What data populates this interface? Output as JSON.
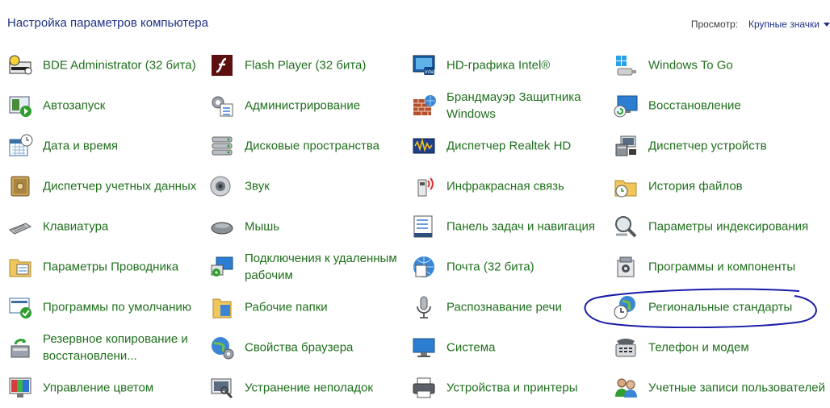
{
  "header": {
    "title": "Настройка параметров компьютера",
    "view_label": "Просмотр:",
    "view_value": "Крупные значки"
  },
  "items": [
    {
      "label": "BDE Administrator (32 бита)",
      "icon": "bde-admin-icon"
    },
    {
      "label": "Flash Player (32 бита)",
      "icon": "flash-player-icon"
    },
    {
      "label": "HD-графика Intel®",
      "icon": "intel-graphics-icon"
    },
    {
      "label": "Windows To Go",
      "icon": "usb-drive-icon"
    },
    {
      "label": "Автозапуск",
      "icon": "autoplay-icon"
    },
    {
      "label": "Администрирование",
      "icon": "admin-tools-icon"
    },
    {
      "label": "Брандмауэр Защитника Windows",
      "icon": "firewall-icon"
    },
    {
      "label": "Восстановление",
      "icon": "recovery-icon"
    },
    {
      "label": "Дата и время",
      "icon": "calendar-clock-icon"
    },
    {
      "label": "Дисковые пространства",
      "icon": "storage-spaces-icon"
    },
    {
      "label": "Диспетчер Realtek HD",
      "icon": "realtek-audio-icon"
    },
    {
      "label": "Диспетчер устройств",
      "icon": "device-manager-icon"
    },
    {
      "label": "Диспетчер учетных данных",
      "icon": "credential-safe-icon"
    },
    {
      "label": "Звук",
      "icon": "speaker-icon"
    },
    {
      "label": "Инфракрасная связь",
      "icon": "infrared-icon"
    },
    {
      "label": "История файлов",
      "icon": "file-history-icon"
    },
    {
      "label": "Клавиатура",
      "icon": "keyboard-icon"
    },
    {
      "label": "Мышь",
      "icon": "mouse-icon"
    },
    {
      "label": "Панель задач и навигация",
      "icon": "taskbar-icon"
    },
    {
      "label": "Параметры индексирования",
      "icon": "indexing-icon"
    },
    {
      "label": "Параметры Проводника",
      "icon": "explorer-options-icon"
    },
    {
      "label": "Подключения к удаленным рабочим",
      "icon": "remote-desktop-icon"
    },
    {
      "label": "Почта (32 бита)",
      "icon": "mail-icon"
    },
    {
      "label": "Программы и компоненты",
      "icon": "programs-icon"
    },
    {
      "label": "Программы по умолчанию",
      "icon": "default-programs-icon"
    },
    {
      "label": "Рабочие папки",
      "icon": "work-folders-icon"
    },
    {
      "label": "Распознавание речи",
      "icon": "microphone-icon"
    },
    {
      "label": "Региональные стандарты",
      "icon": "region-globe-icon"
    },
    {
      "label": "Резервное копирование и восстановлени...",
      "icon": "backup-icon"
    },
    {
      "label": "Свойства браузера",
      "icon": "internet-options-icon"
    },
    {
      "label": "Система",
      "icon": "system-icon"
    },
    {
      "label": "Телефон и модем",
      "icon": "phone-modem-icon"
    },
    {
      "label": "Управление цветом",
      "icon": "color-management-icon"
    },
    {
      "label": "Устранение неполадок",
      "icon": "troubleshooting-icon"
    },
    {
      "label": "Устройства и принтеры",
      "icon": "printer-icon"
    },
    {
      "label": "Учетные записи пользователей",
      "icon": "user-accounts-icon"
    }
  ],
  "colors": {
    "title": "#1e3287",
    "item_text": "#1f6f1c",
    "annotation": "#1a1aa8"
  }
}
